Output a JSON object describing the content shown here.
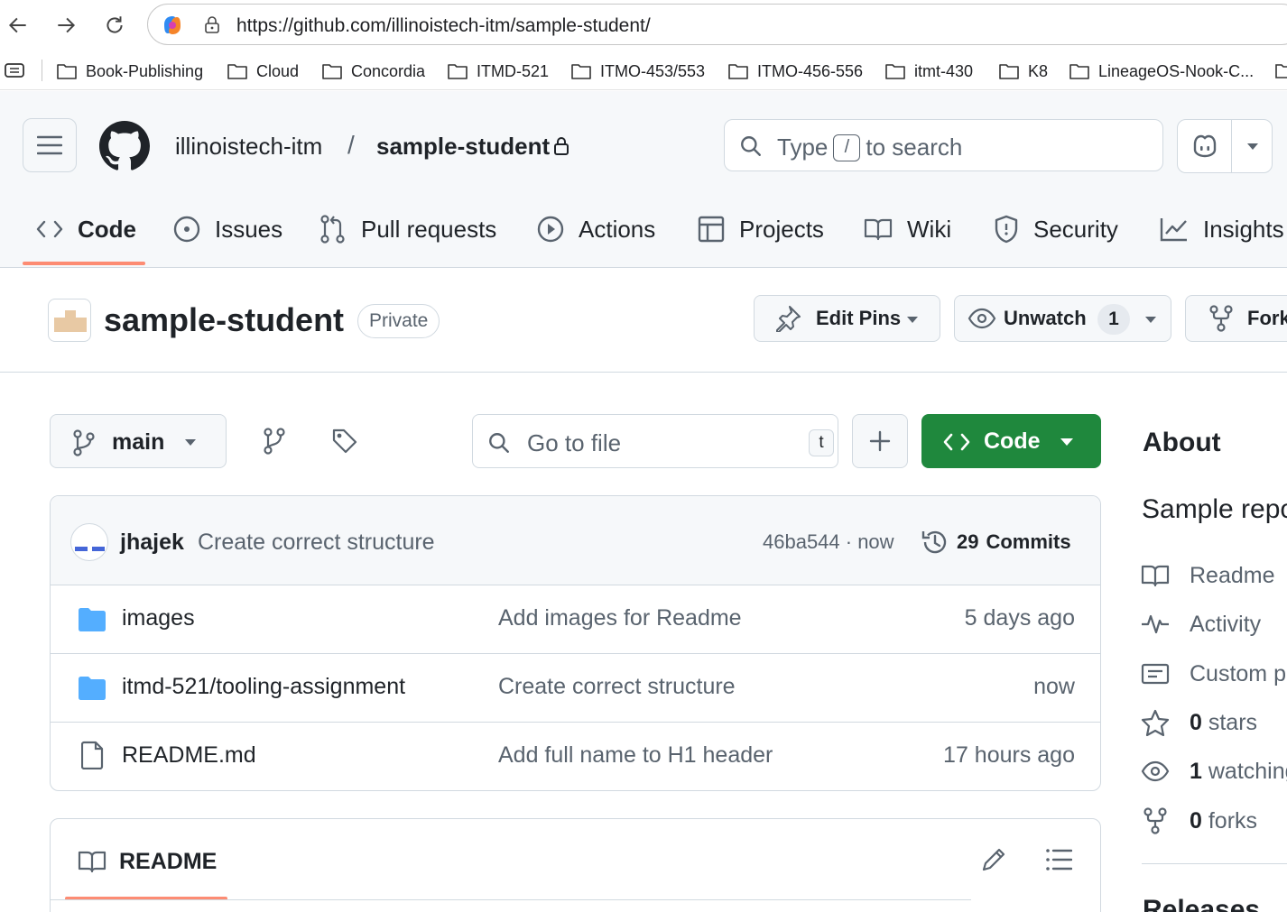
{
  "browser": {
    "url": "https://github.com/illinoistech-itm/sample-student/",
    "bookmarks": [
      "Book-Publishing",
      "Cloud",
      "Concordia",
      "ITMD-521",
      "ITMO-453/553",
      "ITMO-456-556",
      "itmt-430",
      "K8",
      "LineageOS-Nook-C..."
    ]
  },
  "header": {
    "owner": "illinoistech-itm",
    "separator": "/",
    "repo": "sample-student",
    "search": {
      "prefix": "Type",
      "key": "/",
      "suffix": "to search"
    }
  },
  "tabs": [
    {
      "label": "Code",
      "icon": "code-icon",
      "selected": true
    },
    {
      "label": "Issues",
      "icon": "issue-icon"
    },
    {
      "label": "Pull requests",
      "icon": "pull-request-icon"
    },
    {
      "label": "Actions",
      "icon": "play-icon"
    },
    {
      "label": "Projects",
      "icon": "table-icon"
    },
    {
      "label": "Wiki",
      "icon": "book-icon"
    },
    {
      "label": "Security",
      "icon": "shield-icon"
    },
    {
      "label": "Insights",
      "icon": "graph-icon"
    }
  ],
  "repo": {
    "title": "sample-student",
    "visibility": "Private",
    "edit_pins": "Edit Pins",
    "unwatch": "Unwatch",
    "watch_count": "1",
    "fork": "Fork"
  },
  "filenav": {
    "branch": "main",
    "goto_placeholder": "Go to file",
    "goto_key": "t",
    "code_label": "Code"
  },
  "commit": {
    "author": "jhajek",
    "message": "Create correct structure",
    "sha_time": "46ba544 · now",
    "commits_count": "29",
    "commits_label": "Commits"
  },
  "files": [
    {
      "name": "images",
      "type": "folder",
      "message": "Add images for Readme",
      "age": "5 days ago"
    },
    {
      "name": "itmd-521/tooling-assignment",
      "type": "folder",
      "message": "Create correct structure",
      "age": "now"
    },
    {
      "name": "README.md",
      "type": "file",
      "message": "Add full name to H1 header",
      "age": "17 hours ago"
    }
  ],
  "readme": {
    "title": "README"
  },
  "about": {
    "title": "About",
    "description": "Sample repo",
    "items": [
      {
        "icon": "book-icon",
        "count": "",
        "label": "Readme"
      },
      {
        "icon": "pulse-icon",
        "count": "",
        "label": "Activity"
      },
      {
        "icon": "custom-properties-icon",
        "count": "",
        "label": "Custom p"
      },
      {
        "icon": "star-icon",
        "count": "0",
        "label": "stars"
      },
      {
        "icon": "eye-icon",
        "count": "1",
        "label": "watching"
      },
      {
        "icon": "fork-icon",
        "count": "0",
        "label": "forks"
      }
    ],
    "releases": "Releases"
  },
  "colors": {
    "accent_underline": "#fd8c73",
    "code_button": "#1f883d",
    "folder": "#54aeff"
  }
}
